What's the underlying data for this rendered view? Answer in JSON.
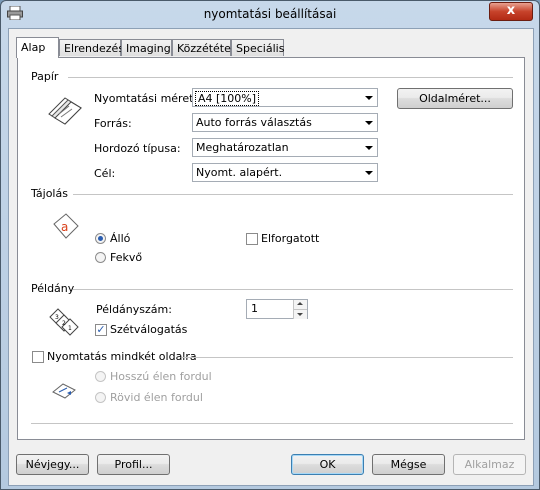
{
  "window": {
    "title": "nyomtatási beállításai",
    "close": "x"
  },
  "tabs": [
    "Alap",
    "Elrendezés",
    "Imaging",
    "Közzététel",
    "Speciális"
  ],
  "paper": {
    "group_label": "Papír",
    "size_label": "Nyomtatási méret:",
    "size_value": "A4  [100%]",
    "page_size_button": "Oldalméret...",
    "source_label": "Forrás:",
    "source_value": "Auto forrás választás",
    "media_label": "Hordozó típusa:",
    "media_value": "Meghatározatlan",
    "target_label": "Cél:",
    "target_value": "Nyomt. alapért."
  },
  "orientation": {
    "group_label": "Tájolás",
    "portrait": "Álló",
    "landscape": "Fekvő",
    "rotated": "Elforgatott"
  },
  "copies": {
    "group_label": "Példány",
    "count_label": "Példányszám:",
    "count_value": "1",
    "collate": "Szétválogatás"
  },
  "duplex": {
    "label": "Nyomtatás mindkét oldalra",
    "long_edge": "Hosszú élen fordul",
    "short_edge": "Rövid élen fordul"
  },
  "footer": {
    "about": "Névjegy...",
    "profile": "Profil...",
    "ok": "OK",
    "cancel": "Mégse",
    "apply": "Alkalmaz"
  }
}
